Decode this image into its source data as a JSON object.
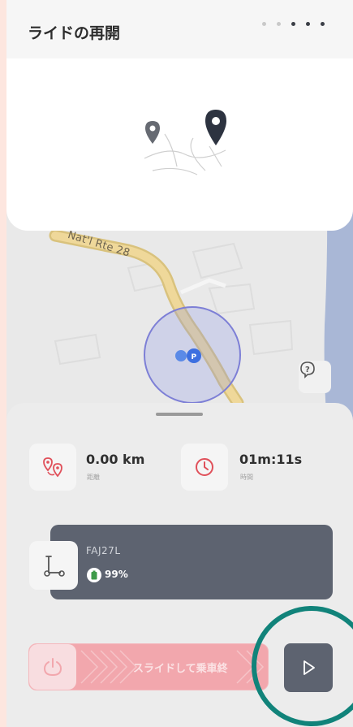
{
  "header": {
    "title": "ライドの再開",
    "page_count": 5,
    "current_page": 3
  },
  "map": {
    "road_label": "Nat'l Rte 28"
  },
  "stats": {
    "distance": {
      "value": "0.00 km",
      "label": "距離"
    },
    "time": {
      "value": "01m:11s",
      "label": "時間"
    }
  },
  "scooter": {
    "id": "FAJ27L",
    "battery": "99%",
    "battery_level": 0.99
  },
  "actions": {
    "slide_text": "スライドして乗車終"
  },
  "colors": {
    "accent": "#11837a",
    "dark": "#5d6370",
    "slider": "#f2a7ad",
    "icon_red": "#e0505a"
  },
  "icons": {
    "pin_route": "route-pin-icon",
    "clock": "clock-icon",
    "scooter": "scooter-icon",
    "battery": "battery-icon",
    "power": "power-icon",
    "play": "play-icon",
    "help": "help-bubble-icon"
  }
}
